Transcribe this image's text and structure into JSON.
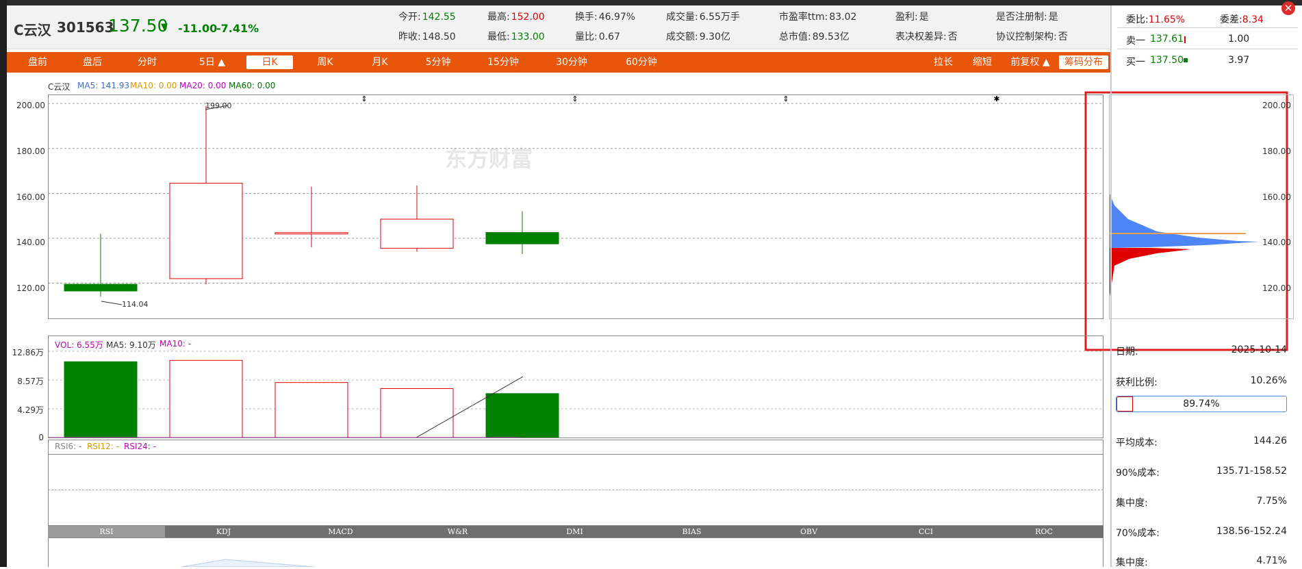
{
  "stock": {
    "name": "C云汉",
    "code": "301563",
    "price": "137.50",
    "arrow": "▼",
    "change": "-11.00",
    "change_pct": "-7.41%"
  },
  "stats": {
    "open_label": "今开:",
    "open": "142.55",
    "prev_close_label": "昨收:",
    "prev_close": "148.50",
    "high_label": "最高:",
    "high": "152.00",
    "low_label": "最低:",
    "low": "133.00",
    "turnover_label": "换手:",
    "turnover": "46.97%",
    "volume_ratio_label": "量比:",
    "volume_ratio": "0.67",
    "volume_label": "成交量:",
    "volume": "6.55万手",
    "amount_label": "成交额:",
    "amount": "9.30亿",
    "pe_label": "市盈率ttm:",
    "pe": "83.02",
    "mktcap_label": "总市值:",
    "mktcap": "89.53亿",
    "profit_label": "盈利:",
    "profit": "是",
    "vote_label": "表决权差异:",
    "vote": "否",
    "registered_label": "是否注册制:",
    "registered": "是",
    "vie_label": "协议控制架构:",
    "vie": "否"
  },
  "orderbook": {
    "weibi_label": "委比:",
    "weibi": "11.65%",
    "weicha_label": "委差:",
    "weicha": "8.34",
    "sell1_label": "卖一",
    "sell1_price": "137.61",
    "sell1_vol": "1.00",
    "buy1_label": "买一",
    "buy1_price": "137.50",
    "buy1_vol": "3.97"
  },
  "tabs": {
    "pre": "盘前",
    "post": "盘后",
    "intraday": "分时",
    "five_day": "5日 ▲",
    "day": "日K",
    "week": "周K",
    "month": "月K",
    "m5": "5分钟",
    "m15": "15分钟",
    "m30": "30分钟",
    "m60": "60分钟",
    "zoom_in": "拉长",
    "zoom_out": "缩短",
    "adjust": "前复权 ▲",
    "chip": "筹码分布"
  },
  "legend": {
    "name": "C云汉",
    "ma5": "MA5: 141.93",
    "ma10": "MA10: 0.00",
    "ma20": "MA20: 0.00",
    "ma60": "MA60: 0.00"
  },
  "vol_legend": {
    "vol": "VOL: 6.55万",
    "ma5": "MA5: 9.10万",
    "ma10": "MA10: -"
  },
  "rsi_legend": {
    "rsi6": "RSI6: -",
    "rsi12": "RSI12: -",
    "rsi24": "RSI24: -"
  },
  "watermark": "东方财富",
  "price_axis": [
    "200.00",
    "180.00",
    "160.00",
    "140.00",
    "120.00"
  ],
  "vol_axis": [
    "12.86万",
    "8.57万",
    "4.29万",
    "0"
  ],
  "annotations": {
    "high": "199.00",
    "low": "114.04"
  },
  "indicator_tabs": [
    "RSI",
    "KDJ",
    "MACD",
    "W&R",
    "DMI",
    "BIAS",
    "OBV",
    "CCI",
    "ROC"
  ],
  "chip_panel": {
    "date_label": "日期:",
    "date": "2025-10-14",
    "profit_ratio_label": "获利比例:",
    "profit_ratio": "10.26%",
    "bar_pct": "89.74%",
    "avg_cost_label": "平均成本:",
    "avg_cost": "144.26",
    "c90_label": "90%成本:",
    "c90": "135.71-158.52",
    "conc90_label": "集中度:",
    "conc90": "7.75%",
    "c70_label": "70%成本:",
    "c70": "138.56-152.24",
    "conc70_label": "集中度:",
    "conc70": "4.71%"
  },
  "colors": {
    "up": "#e00000",
    "down": "#008000",
    "accent": "#e8560c",
    "chip_profit": "#e00000",
    "chip_loss": "#4f86f7"
  },
  "chart_data": {
    "type": "candlestick",
    "candles": [
      {
        "open": 119.5,
        "close": 116.5,
        "high": 142.0,
        "low": 114.04
      },
      {
        "open": 122.0,
        "close": 164.5,
        "high": 199.0,
        "low": 119.5
      },
      {
        "open": 142.0,
        "close": 142.5,
        "high": 163.0,
        "low": 136.0
      },
      {
        "open": 135.5,
        "close": 148.5,
        "high": 163.5,
        "low": 134.0
      },
      {
        "open": 142.55,
        "close": 137.5,
        "high": 152.0,
        "low": 133.0
      }
    ],
    "volumes_wan": [
      11.3,
      11.5,
      8.2,
      7.3,
      6.55
    ],
    "price_ylim": [
      104,
      204
    ],
    "vol_ylim": [
      0,
      12.86
    ]
  }
}
